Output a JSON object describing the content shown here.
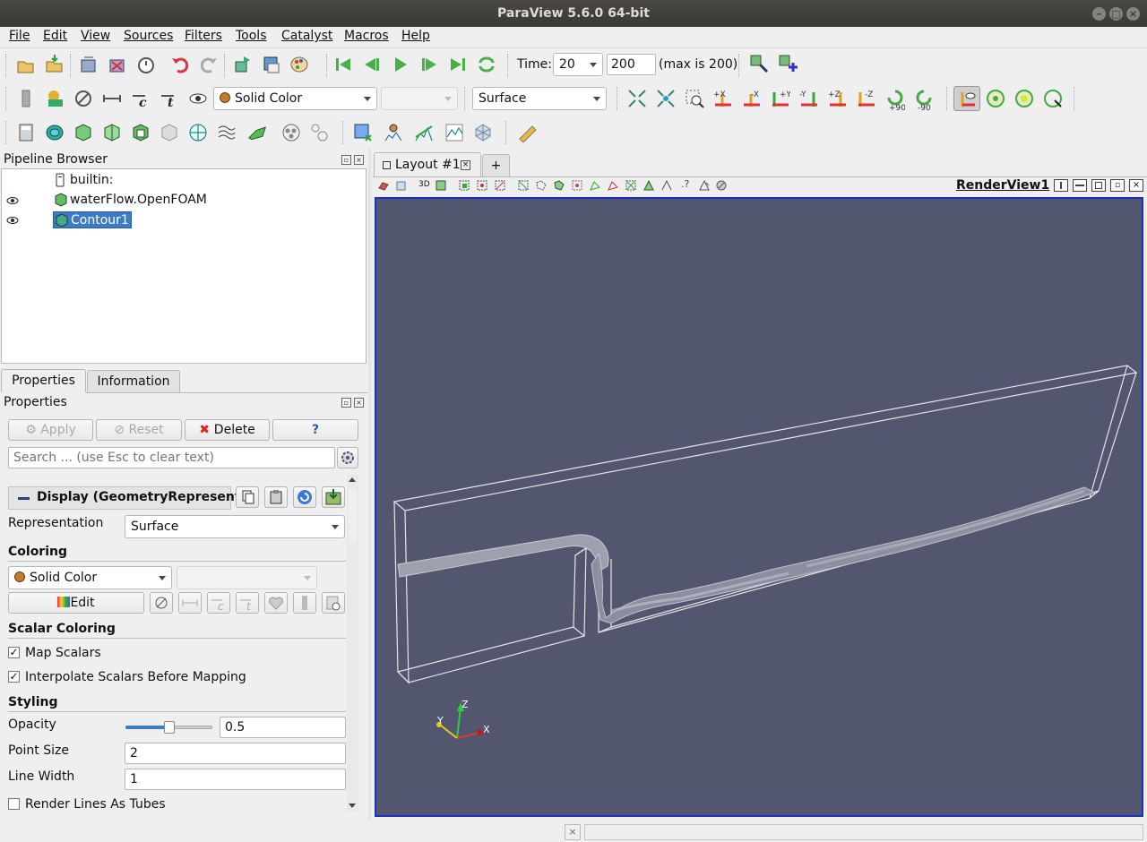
{
  "window": {
    "title": "ParaView 5.6.0 64-bit"
  },
  "menu": [
    "File",
    "Edit",
    "View",
    "Sources",
    "Filters",
    "Tools",
    "Catalyst",
    "Macros",
    "Help"
  ],
  "time": {
    "label": "Time:",
    "value": "20",
    "index": "200",
    "max_text": "(max is 200)"
  },
  "toolbar2": {
    "coloring": "Solid Color",
    "component": "",
    "representation": "Surface"
  },
  "camera": {
    "plus_x": "+X",
    "minus_x": "-X",
    "plus_y": "+Y",
    "minus_y": "-Y",
    "plus_z": "+Z",
    "minus_z": "-Z",
    "rot_pos": "+90",
    "rot_neg": "-90"
  },
  "pipeline": {
    "title": "Pipeline Browser",
    "items": [
      "builtin:",
      "waterFlow.OpenFOAM",
      "Contour1"
    ]
  },
  "tabs": {
    "properties": "Properties",
    "information": "Information"
  },
  "properties": {
    "title": "Properties",
    "apply": "Apply",
    "reset": "Reset",
    "delete": "Delete",
    "help": "?",
    "search_placeholder": "Search ... (use Esc to clear text)",
    "display_header": "Display (GeometryRepresent",
    "representation_label": "Representation",
    "representation_value": "Surface",
    "coloring_header": "Coloring",
    "coloring_value": "Solid Color",
    "edit": "Edit",
    "scalar_header": "Scalar Coloring",
    "map_scalars": "Map Scalars",
    "map_scalars_checked": true,
    "interpolate": "Interpolate Scalars Before Mapping",
    "interpolate_checked": true,
    "styling_header": "Styling",
    "opacity_label": "Opacity",
    "opacity_value": "0.5",
    "opacity_fraction": 0.5,
    "point_size_label": "Point Size",
    "point_size_value": "2",
    "line_width_label": "Line Width",
    "line_width_value": "1",
    "tubes": "Render Lines As Tubes",
    "tubes_checked": false
  },
  "layout": {
    "tab": "Layout #1",
    "add": "+",
    "view_name": "RenderView1",
    "threed": "3D"
  },
  "axes": {
    "x": "X",
    "y": "Y",
    "z": "Z"
  },
  "colors": {
    "view_bg": "#52566e",
    "highlight": "#3d7bc5",
    "view_border": "#1a2fc8"
  }
}
